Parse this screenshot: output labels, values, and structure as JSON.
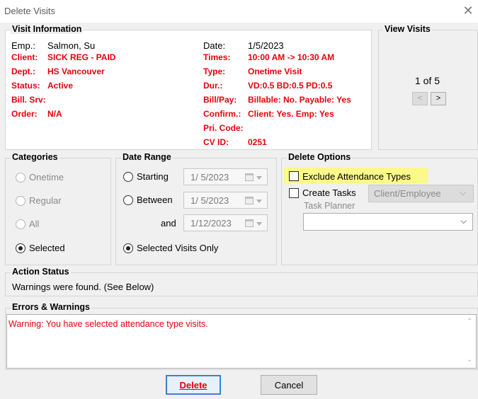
{
  "window": {
    "title": "Delete Visits"
  },
  "visit_info": {
    "label": "Visit Information",
    "emp_label": "Emp.:",
    "emp_value": "Salmon, Su",
    "client_label": "Client:",
    "client_value": "SICK REG - PAID",
    "dept_label": "Dept.:",
    "dept_value": "HS Vancouver",
    "status_label": "Status:",
    "status_value": "Active",
    "billsrv_label": "Bill. Srv:",
    "order_label": "Order:",
    "order_value": "N/A",
    "date_label": "Date:",
    "date_value": "1/5/2023",
    "times_label": "Times:",
    "times_value": "10:00 AM -> 10:30 AM",
    "type_label": "Type:",
    "type_value": "Onetime Visit",
    "dur_label": "Dur.:",
    "dur_value": "VD:0.5  BD:0.5  PD:0.5",
    "billpay_label": "Bill/Pay:",
    "billpay_value": "Billable: No. Payable: Yes",
    "confirm_label": "Confirm.:",
    "confirm_value": "Client: Yes. Emp: Yes",
    "pricode_label": "Pri. Code:",
    "cvid_label": "CV ID:",
    "cvid_value": "0251"
  },
  "view_visits": {
    "label": "View Visits",
    "counter": "1 of 5",
    "prev": "<",
    "next": ">"
  },
  "categories": {
    "label": "Categories",
    "options": [
      "Onetime",
      "Regular",
      "All",
      "Selected"
    ],
    "selected": "Selected"
  },
  "date_range": {
    "label": "Date Range",
    "starting_label": "Starting",
    "starting_value": "1/  5/2023",
    "between_label": "Between",
    "between_value": "1/  5/2023",
    "and_label": "and",
    "and_value": "1/12/2023",
    "selected_only_label": "Selected Visits Only",
    "selected": "Selected Visits Only"
  },
  "delete_options": {
    "label": "Delete Options",
    "exclude_label": "Exclude Attendance Types",
    "exclude_checked": false,
    "create_tasks_label": "Create Tasks",
    "create_tasks_checked": false,
    "task_for_value": "Client/Employee",
    "task_planner_label": "Task Planner",
    "task_planner_value": ""
  },
  "action_status": {
    "label": "Action Status",
    "text": "Warnings were found. (See Below)"
  },
  "errors": {
    "label": "Errors & Warnings",
    "text": "Warning: You have selected attendance type visits."
  },
  "buttons": {
    "delete_label": "Delete",
    "cancel_label": "Cancel"
  },
  "colors": {
    "error_red": "#e8000b",
    "highlight": "#fbf98a",
    "focus_blue": "#3c7fd1"
  }
}
